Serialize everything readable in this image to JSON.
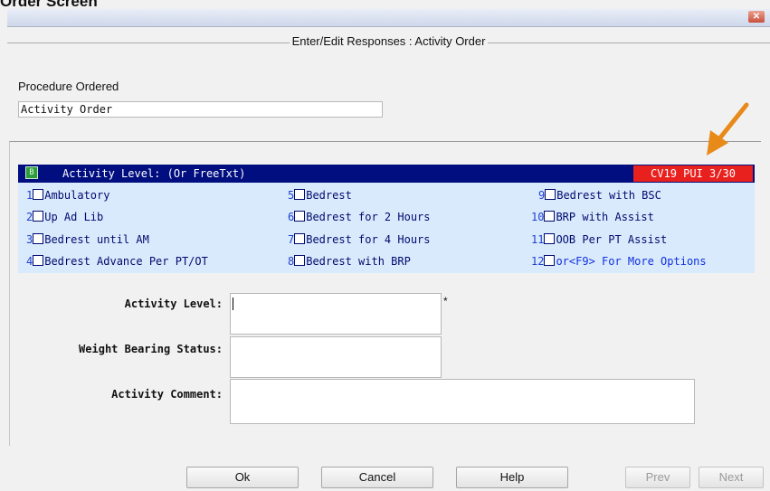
{
  "caption": "Order Screen",
  "window": {
    "close_icon": "close-icon-x",
    "close_glyph": "✕"
  },
  "dialog": {
    "title": "Enter/Edit Responses : Activity Order",
    "procedure_label": "Procedure Ordered",
    "procedure_value": "Activity Order"
  },
  "prompt": {
    "icon": "prompt-icon",
    "icon_glyph": "B",
    "text": "Activity Level: (Or FreeTxt)",
    "flag": "CV19 PUI 3/30"
  },
  "options": [
    {
      "num": "1",
      "label": "Ambulatory"
    },
    {
      "num": "2",
      "label": "Up Ad Lib"
    },
    {
      "num": "3",
      "label": "Bedrest until AM"
    },
    {
      "num": "4",
      "label": "Bedrest Advance Per PT/OT"
    },
    {
      "num": "5",
      "label": "Bedrest"
    },
    {
      "num": "6",
      "label": "Bedrest for 2 Hours"
    },
    {
      "num": "7",
      "label": "Bedrest for 4 Hours"
    },
    {
      "num": "8",
      "label": "Bedrest with BRP"
    },
    {
      "num": "9",
      "label": "Bedrest with BSC"
    },
    {
      "num": "10",
      "label": "BRP with Assist"
    },
    {
      "num": "11",
      "label": "OOB Per PT Assist"
    },
    {
      "num": "12",
      "label": "or<F9> For More Options"
    }
  ],
  "fields": {
    "activity_level_label": "Activity Level:",
    "activity_level_value": "",
    "required_mark": "*",
    "weight_bearing_label": "Weight Bearing Status:",
    "weight_bearing_value": "",
    "activity_comment_label": "Activity Comment:",
    "activity_comment_value": ""
  },
  "buttons": {
    "ok": "Ok",
    "cancel": "Cancel",
    "help": "Help",
    "prev": "Prev",
    "next": "Next"
  }
}
